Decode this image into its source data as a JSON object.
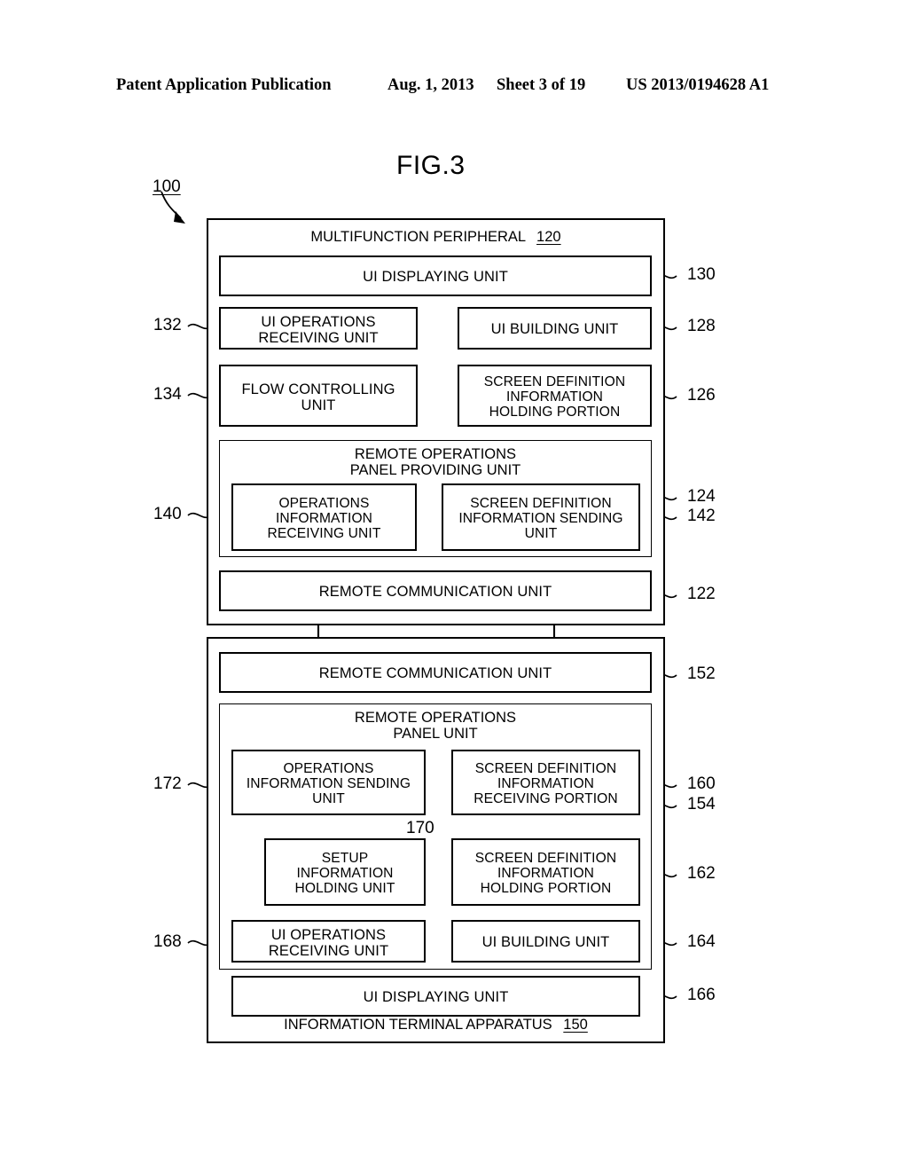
{
  "header": {
    "publication": "Patent Application Publication",
    "date": "Aug. 1, 2013",
    "sheet": "Sheet 3 of 19",
    "patent_number": "US 2013/0194628 A1"
  },
  "figure": {
    "title": "FIG.3",
    "system_ref": "100"
  },
  "mfp": {
    "title": "MULTIFUNCTION PERIPHERAL",
    "ref": "120",
    "boxes": {
      "ui_displaying": {
        "label": "UI DISPLAYING UNIT",
        "ref": "130"
      },
      "ui_operations_receiving": {
        "label": "UI OPERATIONS\nRECEIVING UNIT",
        "ref": "132"
      },
      "ui_building": {
        "label": "UI BUILDING UNIT",
        "ref": "128"
      },
      "flow_controlling": {
        "label": "FLOW CONTROLLING\nUNIT",
        "ref": "134"
      },
      "screen_def_holding": {
        "label": "SCREEN DEFINITION\nINFORMATION\nHOLDING PORTION",
        "ref": "126"
      },
      "remote_panel_providing": {
        "label": "REMOTE OPERATIONS\nPANEL PROVIDING UNIT",
        "ref": "124"
      },
      "operations_info_receiving": {
        "label": "OPERATIONS\nINFORMATION\nRECEIVING UNIT",
        "ref": "140"
      },
      "screen_def_sending": {
        "label": "SCREEN DEFINITION\nINFORMATION SENDING\nUNIT",
        "ref": "142"
      },
      "remote_communication": {
        "label": "REMOTE COMMUNICATION UNIT",
        "ref": "122"
      }
    }
  },
  "terminal": {
    "title": "INFORMATION TERMINAL APPARATUS",
    "ref": "150",
    "boxes": {
      "remote_communication": {
        "label": "REMOTE COMMUNICATION UNIT",
        "ref": "152"
      },
      "remote_panel_unit": {
        "label": "REMOTE OPERATIONS\nPANEL UNIT",
        "ref": "154"
      },
      "operations_info_sending": {
        "label": "OPERATIONS\nINFORMATION SENDING\nUNIT",
        "ref": "172"
      },
      "screen_def_receiving": {
        "label": "SCREEN DEFINITION\nINFORMATION\nRECEIVING PORTION",
        "ref": "160"
      },
      "setup_info_holding": {
        "label": "SETUP\nINFORMATION\nHOLDING UNIT",
        "ref": "170"
      },
      "screen_def_holding": {
        "label": "SCREEN DEFINITION\nINFORMATION\nHOLDING PORTION",
        "ref": "162"
      },
      "ui_operations_receiving": {
        "label": "UI OPERATIONS\nRECEIVING UNIT",
        "ref": "168"
      },
      "ui_building": {
        "label": "UI BUILDING UNIT",
        "ref": "164"
      },
      "ui_displaying": {
        "label": "UI DISPLAYING UNIT",
        "ref": "166"
      }
    }
  }
}
